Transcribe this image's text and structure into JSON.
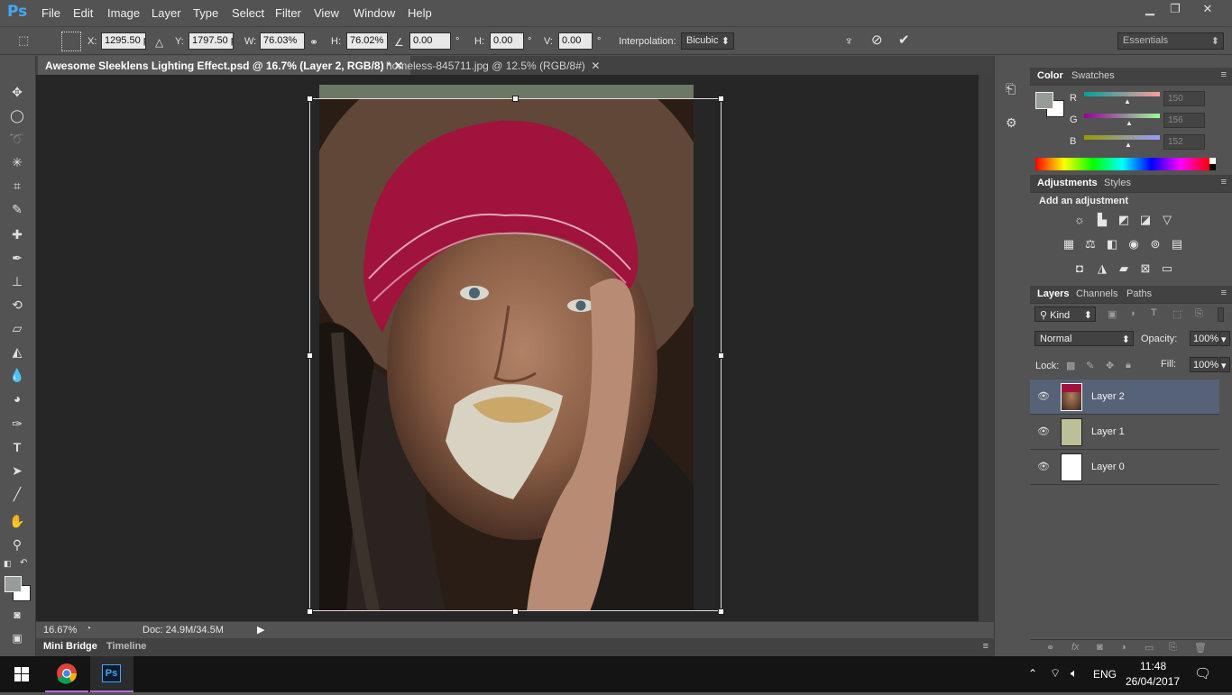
{
  "app": {
    "logo": "Ps"
  },
  "menu": [
    "File",
    "Edit",
    "Image",
    "Layer",
    "Type",
    "Select",
    "Filter",
    "View",
    "Window",
    "Help"
  ],
  "window_controls": {
    "minimize": "▁",
    "restore": "❐",
    "close": "✕"
  },
  "options_bar": {
    "x_label": "X:",
    "x_value": "1295.50 p:",
    "y_label": "Y:",
    "y_value": "1797.50 p:",
    "w_label": "W:",
    "w_value": "76.03%",
    "h_label": "H:",
    "h_value": "76.02%",
    "angle_value": "0.00",
    "angle_unit": "°",
    "hskew_label": "H:",
    "hskew_value": "0.00",
    "hskew_unit": "°",
    "vskew_label": "V:",
    "vskew_value": "0.00",
    "vskew_unit": "°",
    "interp_label": "Interpolation:",
    "interp_value": "Bicubic",
    "workspace": "Essentials"
  },
  "tabs": [
    {
      "label": "Awesome Sleeklens Lighting Effect.psd @ 16.7% (Layer 2, RGB/8) *",
      "close": "✕"
    },
    {
      "label": "homeless-845711.jpg @ 12.5% (RGB/8#)",
      "close": "✕"
    }
  ],
  "status": {
    "zoom": "16.67%",
    "doc": "Doc: 24.9M/34.5M"
  },
  "bottom_tabs": [
    "Mini Bridge",
    "Timeline"
  ],
  "color_panel": {
    "tabs": [
      "Color",
      "Swatches"
    ],
    "channels": [
      {
        "label": "R",
        "value": "150"
      },
      {
        "label": "G",
        "value": "156"
      },
      {
        "label": "B",
        "value": "152"
      }
    ],
    "foreground": "#969c98"
  },
  "adjustments_panel": {
    "tabs": [
      "Adjustments",
      "Styles"
    ],
    "title": "Add an adjustment"
  },
  "layers_panel": {
    "tabs": [
      "Layers",
      "Channels",
      "Paths"
    ],
    "kind": "Kind",
    "blend_mode": "Normal",
    "opacity_label": "Opacity:",
    "opacity_value": "100%",
    "lock_label": "Lock:",
    "fill_label": "Fill:",
    "fill_value": "100%",
    "layers": [
      {
        "name": "Layer 2",
        "selected": true
      },
      {
        "name": "Layer 1",
        "selected": false
      },
      {
        "name": "Layer 0",
        "selected": false
      }
    ]
  },
  "taskbar": {
    "language": "ENG",
    "time": "11:48",
    "date": "26/04/2017"
  },
  "colors": {
    "accent": "#41a8f6",
    "panel": "#535353",
    "dark": "#424242",
    "canvas": "#262626",
    "selected_layer": "#566278"
  }
}
